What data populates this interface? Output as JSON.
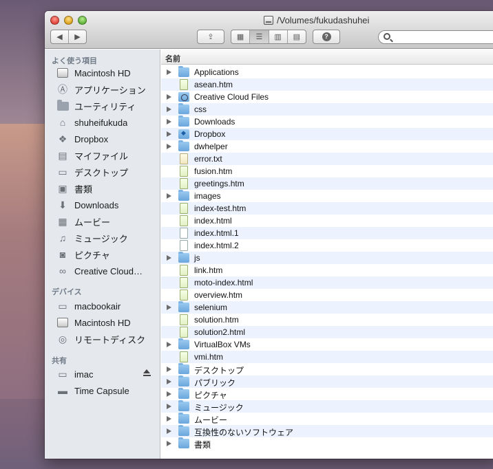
{
  "window": {
    "title": "/Volumes/fukudashuhei"
  },
  "toolbar": {
    "back": "◀",
    "forward": "▶",
    "share": "⇪",
    "view_icon": "▦",
    "view_list": "☰",
    "view_column": "▥",
    "view_coverflow": "▤",
    "action": "?",
    "search_placeholder": ""
  },
  "sidebar": {
    "favorites_header": "よく使う項目",
    "favorites": [
      {
        "label": "Macintosh HD",
        "icon": "hdd-icon"
      },
      {
        "label": "アプリケーション",
        "icon": "applications-icon"
      },
      {
        "label": "ユーティリティ",
        "icon": "folder-icon"
      },
      {
        "label": "shuheifukuda",
        "icon": "home-icon"
      },
      {
        "label": "Dropbox",
        "icon": "dropbox-icon"
      },
      {
        "label": "マイファイル",
        "icon": "all-my-files-icon"
      },
      {
        "label": "デスクトップ",
        "icon": "desktop-icon"
      },
      {
        "label": "書類",
        "icon": "documents-icon"
      },
      {
        "label": "Downloads",
        "icon": "downloads-icon"
      },
      {
        "label": "ムービー",
        "icon": "movies-icon"
      },
      {
        "label": "ミュージック",
        "icon": "music-icon"
      },
      {
        "label": "ピクチャ",
        "icon": "pictures-icon"
      },
      {
        "label": "Creative Cloud…",
        "icon": "creative-cloud-icon"
      }
    ],
    "devices_header": "デバイス",
    "devices": [
      {
        "label": "macbookair",
        "icon": "laptop-icon"
      },
      {
        "label": "Macintosh HD",
        "icon": "hdd-icon"
      },
      {
        "label": "リモートディスク",
        "icon": "remote-disc-icon"
      }
    ],
    "shared_header": "共有",
    "shared": [
      {
        "label": "imac",
        "icon": "imac-icon"
      },
      {
        "label": "Time Capsule",
        "icon": "time-capsule-icon"
      }
    ]
  },
  "file_list": {
    "column_name": "名前",
    "rows": [
      {
        "name": "Applications",
        "type": "folder"
      },
      {
        "name": "asean.htm",
        "type": "html"
      },
      {
        "name": "Creative Cloud Files",
        "type": "cc-folder"
      },
      {
        "name": "css",
        "type": "folder"
      },
      {
        "name": "Downloads",
        "type": "folder"
      },
      {
        "name": "Dropbox",
        "type": "dropbox-folder"
      },
      {
        "name": "dwhelper",
        "type": "folder"
      },
      {
        "name": "error.txt",
        "type": "txt"
      },
      {
        "name": "fusion.htm",
        "type": "html"
      },
      {
        "name": "greetings.htm",
        "type": "html"
      },
      {
        "name": "images",
        "type": "folder"
      },
      {
        "name": "index-test.htm",
        "type": "html"
      },
      {
        "name": "index.html",
        "type": "html"
      },
      {
        "name": "index.html.1",
        "type": "plain"
      },
      {
        "name": "index.html.2",
        "type": "plain"
      },
      {
        "name": "js",
        "type": "folder"
      },
      {
        "name": "link.htm",
        "type": "html"
      },
      {
        "name": "moto-index.html",
        "type": "html"
      },
      {
        "name": "overview.htm",
        "type": "html"
      },
      {
        "name": "selenium",
        "type": "folder"
      },
      {
        "name": "solution.htm",
        "type": "html"
      },
      {
        "name": "solution2.html",
        "type": "html"
      },
      {
        "name": "VirtualBox VMs",
        "type": "folder"
      },
      {
        "name": "vmi.htm",
        "type": "html"
      },
      {
        "name": "デスクトップ",
        "type": "folder"
      },
      {
        "name": "パブリック",
        "type": "folder"
      },
      {
        "name": "ピクチャ",
        "type": "folder"
      },
      {
        "name": "ミュージック",
        "type": "folder"
      },
      {
        "name": "ムービー",
        "type": "folder"
      },
      {
        "name": "互換性のないソフトウェア",
        "type": "folder"
      },
      {
        "name": "書類",
        "type": "folder"
      }
    ]
  }
}
